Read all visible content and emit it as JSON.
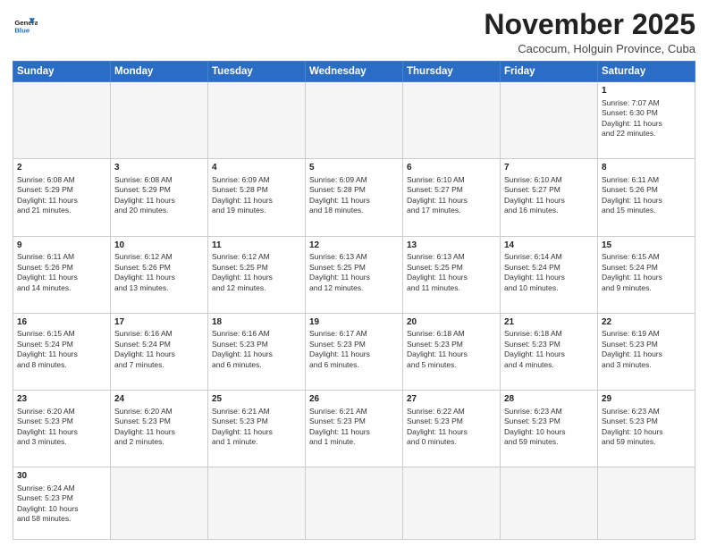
{
  "header": {
    "logo": {
      "line1": "General",
      "line2": "Blue"
    },
    "title": "November 2025",
    "location": "Cacocum, Holguin Province, Cuba"
  },
  "weekdays": [
    "Sunday",
    "Monday",
    "Tuesday",
    "Wednesday",
    "Thursday",
    "Friday",
    "Saturday"
  ],
  "weeks": [
    [
      {
        "day": null,
        "text": ""
      },
      {
        "day": null,
        "text": ""
      },
      {
        "day": null,
        "text": ""
      },
      {
        "day": null,
        "text": ""
      },
      {
        "day": null,
        "text": ""
      },
      {
        "day": null,
        "text": ""
      },
      {
        "day": 1,
        "text": "Sunrise: 7:07 AM\nSunset: 6:30 PM\nDaylight: 11 hours\nand 22 minutes."
      }
    ],
    [
      {
        "day": 2,
        "text": "Sunrise: 6:08 AM\nSunset: 5:29 PM\nDaylight: 11 hours\nand 21 minutes."
      },
      {
        "day": 3,
        "text": "Sunrise: 6:08 AM\nSunset: 5:29 PM\nDaylight: 11 hours\nand 20 minutes."
      },
      {
        "day": 4,
        "text": "Sunrise: 6:09 AM\nSunset: 5:28 PM\nDaylight: 11 hours\nand 19 minutes."
      },
      {
        "day": 5,
        "text": "Sunrise: 6:09 AM\nSunset: 5:28 PM\nDaylight: 11 hours\nand 18 minutes."
      },
      {
        "day": 6,
        "text": "Sunrise: 6:10 AM\nSunset: 5:27 PM\nDaylight: 11 hours\nand 17 minutes."
      },
      {
        "day": 7,
        "text": "Sunrise: 6:10 AM\nSunset: 5:27 PM\nDaylight: 11 hours\nand 16 minutes."
      },
      {
        "day": 8,
        "text": "Sunrise: 6:11 AM\nSunset: 5:26 PM\nDaylight: 11 hours\nand 15 minutes."
      }
    ],
    [
      {
        "day": 9,
        "text": "Sunrise: 6:11 AM\nSunset: 5:26 PM\nDaylight: 11 hours\nand 14 minutes."
      },
      {
        "day": 10,
        "text": "Sunrise: 6:12 AM\nSunset: 5:26 PM\nDaylight: 11 hours\nand 13 minutes."
      },
      {
        "day": 11,
        "text": "Sunrise: 6:12 AM\nSunset: 5:25 PM\nDaylight: 11 hours\nand 12 minutes."
      },
      {
        "day": 12,
        "text": "Sunrise: 6:13 AM\nSunset: 5:25 PM\nDaylight: 11 hours\nand 12 minutes."
      },
      {
        "day": 13,
        "text": "Sunrise: 6:13 AM\nSunset: 5:25 PM\nDaylight: 11 hours\nand 11 minutes."
      },
      {
        "day": 14,
        "text": "Sunrise: 6:14 AM\nSunset: 5:24 PM\nDaylight: 11 hours\nand 10 minutes."
      },
      {
        "day": 15,
        "text": "Sunrise: 6:15 AM\nSunset: 5:24 PM\nDaylight: 11 hours\nand 9 minutes."
      }
    ],
    [
      {
        "day": 16,
        "text": "Sunrise: 6:15 AM\nSunset: 5:24 PM\nDaylight: 11 hours\nand 8 minutes."
      },
      {
        "day": 17,
        "text": "Sunrise: 6:16 AM\nSunset: 5:24 PM\nDaylight: 11 hours\nand 7 minutes."
      },
      {
        "day": 18,
        "text": "Sunrise: 6:16 AM\nSunset: 5:23 PM\nDaylight: 11 hours\nand 6 minutes."
      },
      {
        "day": 19,
        "text": "Sunrise: 6:17 AM\nSunset: 5:23 PM\nDaylight: 11 hours\nand 6 minutes."
      },
      {
        "day": 20,
        "text": "Sunrise: 6:18 AM\nSunset: 5:23 PM\nDaylight: 11 hours\nand 5 minutes."
      },
      {
        "day": 21,
        "text": "Sunrise: 6:18 AM\nSunset: 5:23 PM\nDaylight: 11 hours\nand 4 minutes."
      },
      {
        "day": 22,
        "text": "Sunrise: 6:19 AM\nSunset: 5:23 PM\nDaylight: 11 hours\nand 3 minutes."
      }
    ],
    [
      {
        "day": 23,
        "text": "Sunrise: 6:20 AM\nSunset: 5:23 PM\nDaylight: 11 hours\nand 3 minutes."
      },
      {
        "day": 24,
        "text": "Sunrise: 6:20 AM\nSunset: 5:23 PM\nDaylight: 11 hours\nand 2 minutes."
      },
      {
        "day": 25,
        "text": "Sunrise: 6:21 AM\nSunset: 5:23 PM\nDaylight: 11 hours\nand 1 minute."
      },
      {
        "day": 26,
        "text": "Sunrise: 6:21 AM\nSunset: 5:23 PM\nDaylight: 11 hours\nand 1 minute."
      },
      {
        "day": 27,
        "text": "Sunrise: 6:22 AM\nSunset: 5:23 PM\nDaylight: 11 hours\nand 0 minutes."
      },
      {
        "day": 28,
        "text": "Sunrise: 6:23 AM\nSunset: 5:23 PM\nDaylight: 10 hours\nand 59 minutes."
      },
      {
        "day": 29,
        "text": "Sunrise: 6:23 AM\nSunset: 5:23 PM\nDaylight: 10 hours\nand 59 minutes."
      }
    ],
    [
      {
        "day": 30,
        "text": "Sunrise: 6:24 AM\nSunset: 5:23 PM\nDaylight: 10 hours\nand 58 minutes."
      },
      {
        "day": null,
        "text": ""
      },
      {
        "day": null,
        "text": ""
      },
      {
        "day": null,
        "text": ""
      },
      {
        "day": null,
        "text": ""
      },
      {
        "day": null,
        "text": ""
      },
      {
        "day": null,
        "text": ""
      }
    ]
  ]
}
